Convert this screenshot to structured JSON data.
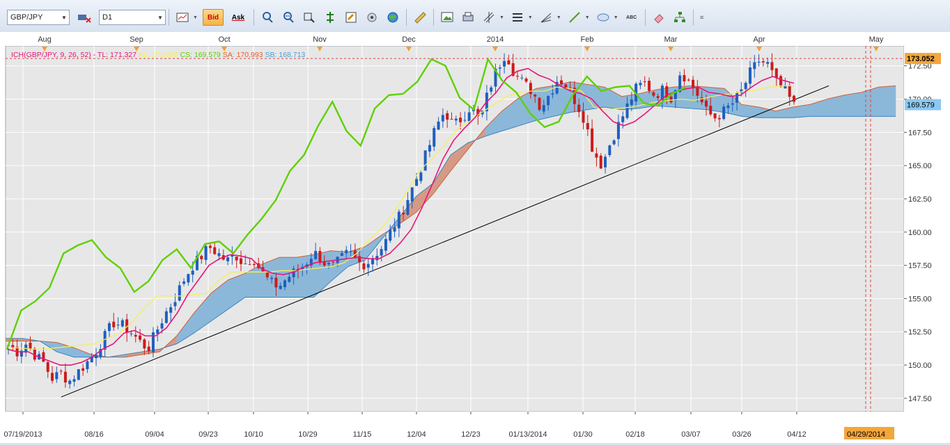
{
  "toolbar": {
    "symbol": "GBP/JPY",
    "timeframe": "D1",
    "bid_label": "Bid",
    "ask_label": "Ask",
    "abc_label": "ABC"
  },
  "colors": {
    "plot_bg": "#e7e7e7",
    "grid": "#ffffff",
    "bull": "#1e5fbf",
    "bear": "#cc1b1b",
    "tenkan": "#e6157a",
    "kijun": "#f5ef5a",
    "chikou": "#5fd000",
    "cloud_bull": "#8bb8d9",
    "cloud_bear": "#d69a84",
    "last_price_tag": "#f3a63c",
    "cs_tag": "#8cc8f2"
  },
  "chart_data": {
    "type": "candlestick",
    "title": "ICH(GBP/JPY, 9, 26, 52)",
    "legend": [
      {
        "label": "TL: 171.327",
        "color": "#e6157a"
      },
      {
        "label": "KL: 171.008",
        "color": "#f5ef5a"
      },
      {
        "label": "CS: 169.579",
        "color": "#5fd000"
      },
      {
        "label": "SA: 170.993",
        "color": "#e0602a"
      },
      {
        "label": "SB: 168.713",
        "color": "#4aa0d8"
      }
    ],
    "ylim": [
      146.5,
      174.0
    ],
    "y_ticks": [
      "147.50",
      "150.00",
      "152.50",
      "155.00",
      "157.50",
      "160.00",
      "162.50",
      "165.00",
      "167.50",
      "170.00",
      "172.50"
    ],
    "x_date_labels": [
      "07/19/2013",
      "08/16",
      "09/04",
      "09/23",
      "10/10",
      "10/29",
      "11/15",
      "12/04",
      "12/23",
      "01/13/2014",
      "01/30",
      "02/18",
      "03/07",
      "03/26",
      "04/12"
    ],
    "month_labels": [
      "Aug",
      "Sep",
      "Oct",
      "Nov",
      "Dec",
      "2014",
      "Feb",
      "Mar",
      "Apr",
      "May"
    ],
    "price_tag_last": "173.052",
    "price_tag_cs": "169.579",
    "date_tag": "04/29/2014",
    "grid": true,
    "price_path": [
      151.5,
      151.0,
      151.6,
      150.8,
      150.2,
      149.0,
      149.4,
      148.8,
      149.5,
      150.2,
      151.0,
      152.1,
      153.2,
      153.0,
      152.5,
      151.8,
      151.2,
      152.6,
      153.9,
      154.9,
      156.3,
      157.4,
      158.1,
      158.9,
      158.4,
      157.8,
      158.3,
      157.6,
      158.1,
      157.0,
      156.2,
      155.9,
      156.6,
      157.1,
      157.6,
      158.5,
      157.8,
      157.3,
      157.9,
      158.5,
      157.7,
      157.6,
      158.3,
      159.0,
      160.3,
      161.4,
      162.9,
      164.4,
      166.1,
      167.9,
      169.1,
      168.0,
      168.6,
      169.5,
      168.3,
      170.6,
      172.3,
      173.5,
      171.9,
      171.2,
      170.6,
      169.4,
      170.4,
      171.6,
      170.9,
      169.8,
      168.5,
      166.1,
      165.0,
      166.8,
      168.2,
      169.6,
      170.9,
      171.2,
      170.3,
      170.7,
      170.1,
      172.1,
      171.3,
      170.3,
      169.0,
      168.6,
      169.1,
      169.7,
      170.6,
      172.0,
      172.9,
      172.6,
      171.2,
      170.6,
      169.5
    ],
    "price_range": [
      147.6,
      173.2
    ],
    "tenkan": [
      151.2,
      151.0,
      151.0,
      150.6,
      150.3,
      150.0,
      150.0,
      150.2,
      150.6,
      151.2,
      151.6,
      152.4,
      152.6,
      152.2,
      152.2,
      152.8,
      153.9,
      155.3,
      156.4,
      157.5,
      158.0,
      158.3,
      158.2,
      158.0,
      157.2,
      156.9,
      156.8,
      157.0,
      157.4,
      157.7,
      157.8,
      157.9,
      158.0,
      158.1,
      158.0,
      158.0,
      158.4,
      159.2,
      160.2,
      161.8,
      163.6,
      165.5,
      166.9,
      167.8,
      168.6,
      169.7,
      170.5,
      171.6,
      172.1,
      172.3,
      171.8,
      171.5,
      171.0,
      170.6,
      170.4,
      170.0,
      169.1,
      168.3,
      168.0,
      168.3,
      168.9,
      169.6,
      170.3,
      170.6,
      170.8,
      170.9,
      170.5,
      170.4,
      170.2,
      170.3,
      170.9,
      171.4,
      171.7,
      171.4,
      171.2
    ],
    "kijun": [
      151.3,
      151.3,
      151.2,
      151.2,
      151.3,
      151.4,
      151.5,
      151.6,
      152.0,
      152.4,
      153.2,
      154.3,
      155.2,
      155.2,
      155.2,
      155.3,
      155.4,
      156.4,
      157.0,
      157.0,
      157.0,
      157.0,
      157.1,
      157.1,
      157.2,
      157.3,
      157.4,
      157.7,
      158.4,
      159.4,
      160.3,
      161.5,
      163.0,
      164.6,
      165.5,
      166.5,
      167.7,
      168.3,
      169.0,
      169.6,
      170.2,
      170.5,
      170.6,
      170.6,
      170.9,
      170.8,
      170.6,
      169.4,
      169.2,
      169.3,
      169.4,
      169.6,
      169.8,
      169.9,
      170.0,
      169.9,
      170.1,
      170.3,
      170.4,
      170.6,
      170.7,
      170.9,
      171.0,
      171.0
    ],
    "chikou": [
      151.2,
      154.1,
      154.8,
      155.8,
      158.4,
      159.0,
      159.4,
      158.1,
      157.3,
      155.5,
      156.3,
      157.9,
      158.7,
      157.3,
      159.1,
      159.3,
      158.4,
      159.8,
      161.0,
      162.4,
      164.6,
      165.8,
      168.0,
      169.8,
      167.6,
      166.5,
      169.3,
      170.3,
      170.4,
      171.3,
      173.0,
      172.5,
      170.1,
      169.2,
      173.0,
      171.4,
      170.5,
      168.9,
      167.9,
      168.3,
      170.3,
      171.7,
      170.6,
      170.9,
      171.0,
      169.7,
      169.5,
      170.4,
      170.9
    ],
    "senkou_a": [
      151.8,
      151.8,
      151.8,
      151.7,
      151.3,
      150.8,
      150.6,
      150.6,
      150.8,
      151.0,
      152.2,
      153.9,
      155.4,
      156.4,
      156.9,
      157.6,
      158.1,
      158.1,
      158.3,
      158.6,
      158.5,
      158.9,
      159.8,
      160.6,
      161.5,
      162.9,
      164.6,
      166.2,
      167.8,
      169.1,
      170.1,
      170.8,
      171.0,
      171.3,
      171.1,
      170.9,
      170.2,
      170.4,
      170.7,
      170.9,
      171.0,
      170.9,
      170.8,
      169.6,
      169.4,
      169.1,
      169.4,
      169.6,
      170.0,
      170.3,
      170.5,
      170.9,
      171.0
    ],
    "senkou_b": [
      152.0,
      152.0,
      151.8,
      151.0,
      150.6,
      150.6,
      150.6,
      150.8,
      151.0,
      151.2,
      151.6,
      152.4,
      153.3,
      154.2,
      155.1,
      155.1,
      155.1,
      155.1,
      155.1,
      156.3,
      157.4,
      157.9,
      159.5,
      161.1,
      162.7,
      163.7,
      165.8,
      166.7,
      167.2,
      167.6,
      168.0,
      168.4,
      168.7,
      169.0,
      169.2,
      169.4,
      169.2,
      169.3,
      169.5,
      169.4,
      169.3,
      169.2,
      169.0,
      168.7,
      168.6,
      168.6,
      168.6,
      168.7,
      168.7,
      168.7,
      168.7,
      168.7,
      168.7
    ],
    "trendline": [
      {
        "date": "07/31/2013",
        "value": 147.6
      },
      {
        "date": "04/25/2014",
        "value": 171.0
      }
    ]
  }
}
